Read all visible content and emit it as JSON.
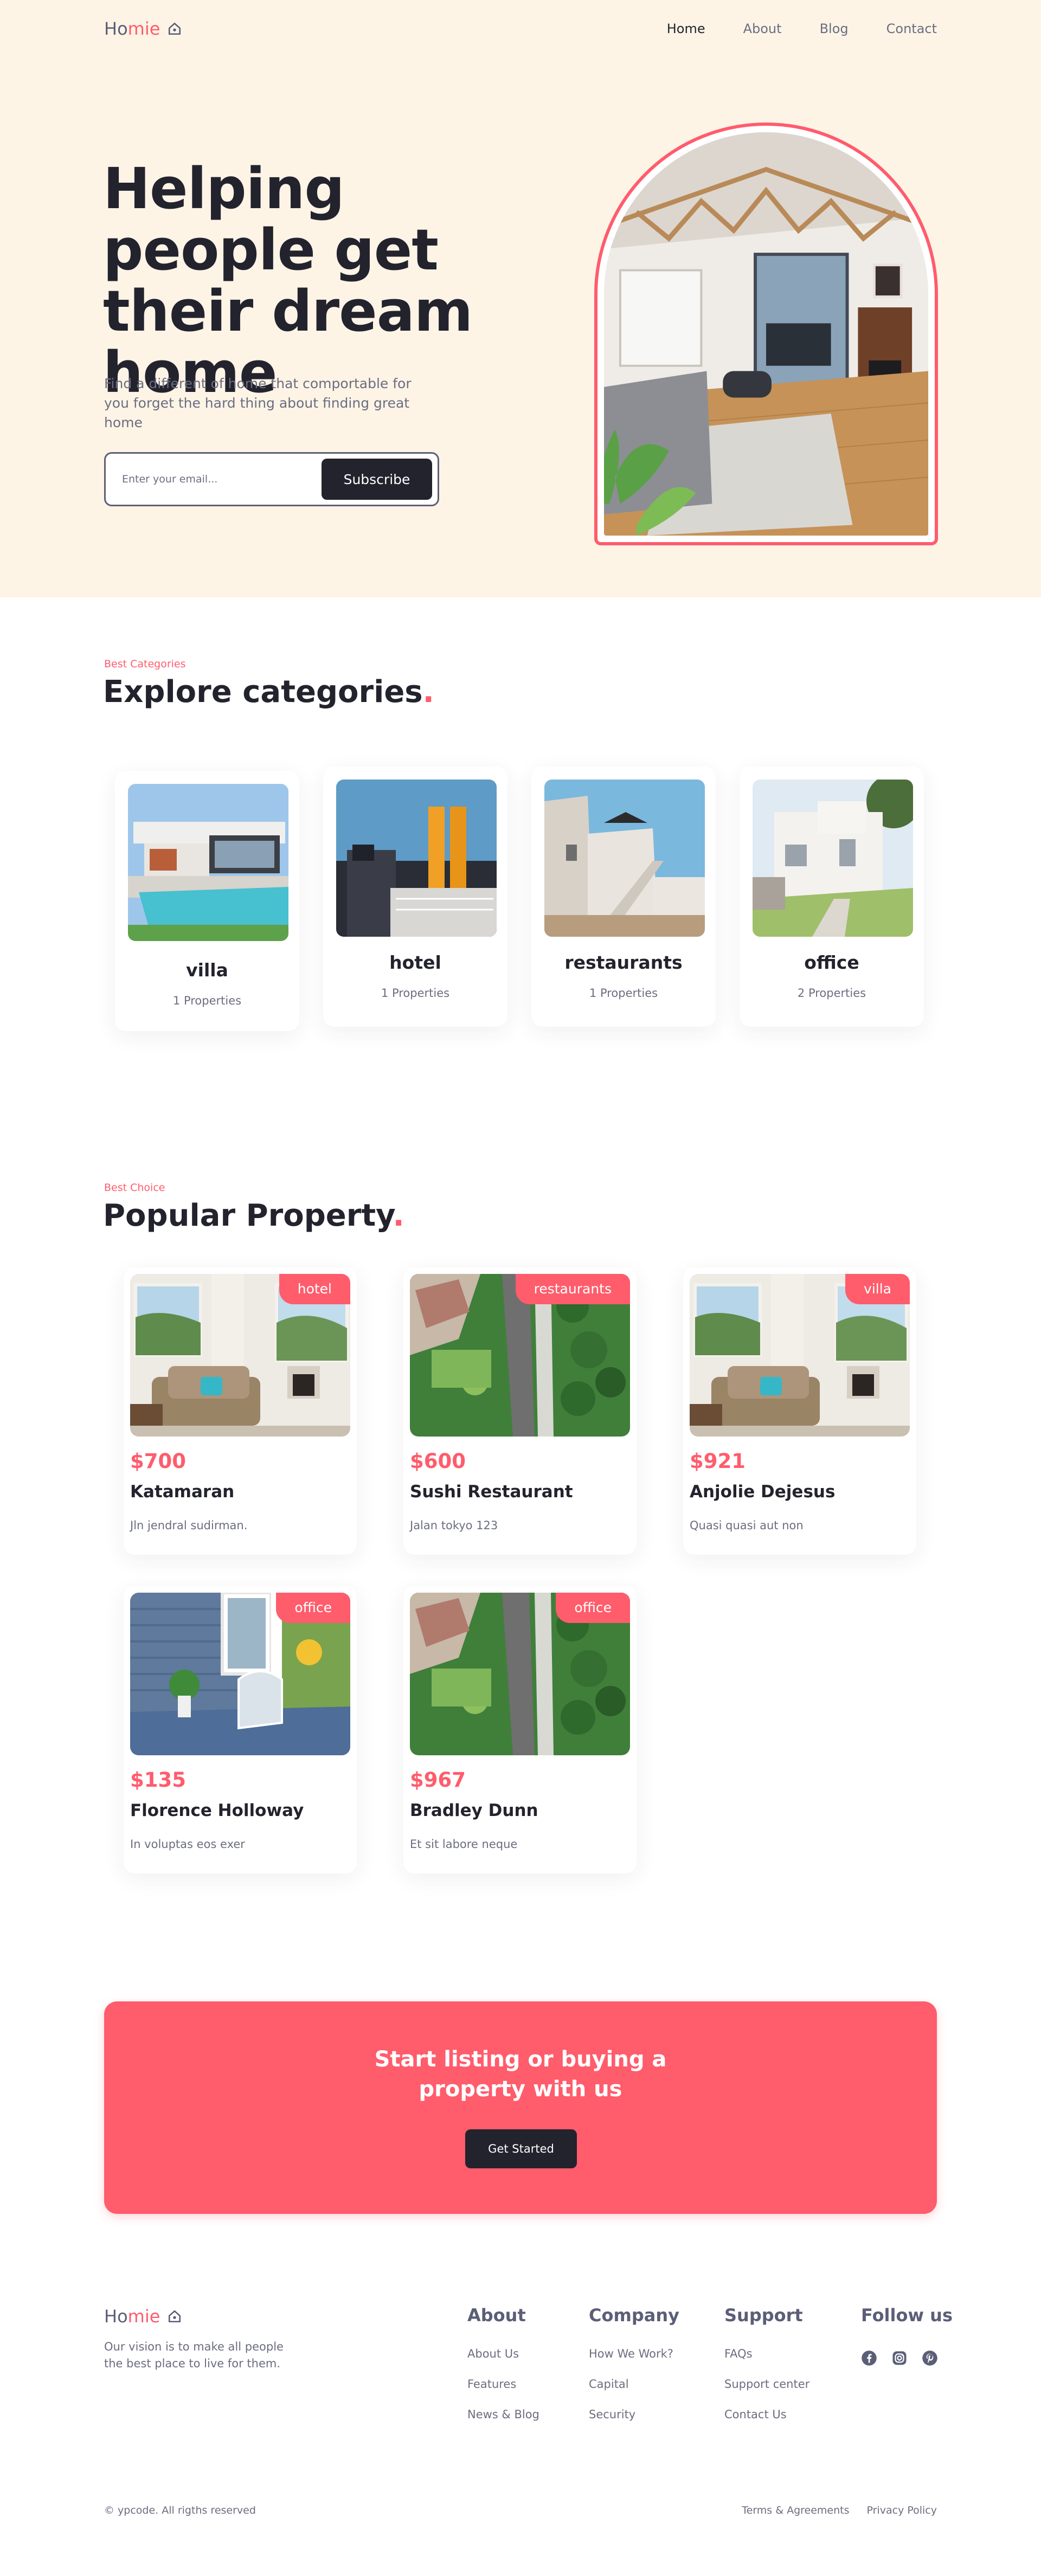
{
  "nav": {
    "logo_ho": "Ho",
    "logo_mie": "mie",
    "links": [
      "Home",
      "About",
      "Blog",
      "Contact"
    ],
    "active": "Home"
  },
  "hero": {
    "title": "Helping people get their dream home",
    "subtitle": "Find a different of home that comportable for you forget the hard thing about finding great home",
    "email_placeholder": "Enter your email...",
    "subscribe_label": "Subscribe"
  },
  "categories": {
    "tag": "Best Categories",
    "title": "Explore categories",
    "items": [
      {
        "name": "villa",
        "count": "1 Properties"
      },
      {
        "name": "hotel",
        "count": "1 Properties"
      },
      {
        "name": "restaurants",
        "count": "1 Properties"
      },
      {
        "name": "office",
        "count": "2 Properties"
      }
    ]
  },
  "properties": {
    "tag": "Best Choice",
    "title": "Popular Property",
    "items": [
      {
        "badge": "hotel",
        "price": "$700",
        "name": "Katamaran",
        "address": "Jln jendral sudirman."
      },
      {
        "badge": "restaurants",
        "price": "$600",
        "name": "Sushi Restaurant",
        "address": "Jalan tokyo 123"
      },
      {
        "badge": "villa",
        "price": "$921",
        "name": "Anjolie Dejesus",
        "address": "Quasi quasi aut non"
      },
      {
        "badge": "office",
        "price": "$135",
        "name": "Florence Holloway",
        "address": "In voluptas eos exer"
      },
      {
        "badge": "office",
        "price": "$967",
        "name": "Bradley Dunn",
        "address": "Et sit labore neque"
      }
    ]
  },
  "cta": {
    "title_line1": "Start listing or buying a",
    "title_line2": "property with us",
    "button": "Get Started"
  },
  "footer": {
    "description": "Our vision is to make all people the best place to live for them.",
    "columns": [
      {
        "title": "About",
        "links": [
          "About Us",
          "Features",
          "News & Blog"
        ]
      },
      {
        "title": "Company",
        "links": [
          "How We Work?",
          "Capital",
          "Security"
        ]
      },
      {
        "title": "Support",
        "links": [
          "FAQs",
          "Support center",
          "Contact Us"
        ]
      }
    ],
    "follow_title": "Follow us",
    "social": [
      "facebook-icon",
      "instagram-icon",
      "pinterest-icon"
    ],
    "copyright": "© ypcode. All rigths reserved",
    "bottom_links": [
      "Terms & Agreements",
      "Privacy Policy"
    ]
  },
  "colors": {
    "accent": "#ff5c6c",
    "dark": "#23232e",
    "hero_bg": "#fdf4e6",
    "muted": "#6b6d80"
  }
}
